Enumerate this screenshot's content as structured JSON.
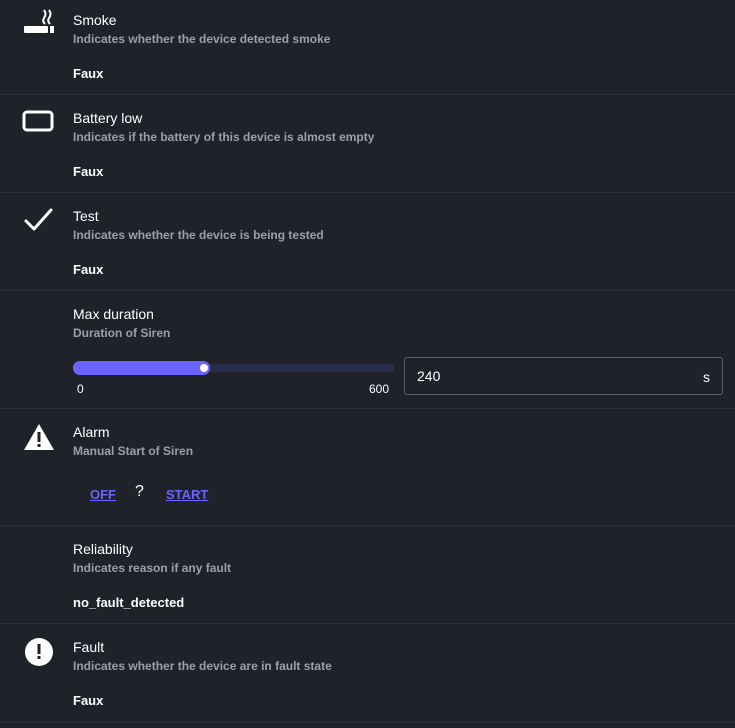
{
  "rows": [
    {
      "icon": "smoking-icon",
      "title": "Smoke",
      "desc": "Indicates whether the device detected smoke",
      "value": "Faux"
    },
    {
      "icon": "battery-low-icon",
      "title": "Battery low",
      "desc": "Indicates if the battery of this device is almost empty",
      "value": "Faux"
    },
    {
      "icon": "checkmark-icon",
      "title": "Test",
      "desc": "Indicates whether the device is being tested",
      "value": "Faux"
    },
    {
      "title": "Max duration",
      "desc": "Duration of Siren",
      "slider": {
        "min": "0",
        "max": "600",
        "value": "240",
        "fraction": 0.4,
        "unit": "s"
      }
    },
    {
      "icon": "warning-icon",
      "title": "Alarm",
      "desc": "Manual Start of Siren",
      "buttons": {
        "off": "OFF",
        "sep": "?",
        "start": "START"
      }
    },
    {
      "title": "Reliability",
      "desc": "Indicates reason if any fault",
      "value": "no_fault_detected"
    },
    {
      "icon": "alert-circle-icon",
      "title": "Fault",
      "desc": "Indicates whether the device are in fault state",
      "value": "Faux"
    }
  ],
  "colors": {
    "background": "#1f2329",
    "accent": "#6b63ff",
    "muted_text": "#9aa0a7",
    "divider": "#2c3139"
  }
}
